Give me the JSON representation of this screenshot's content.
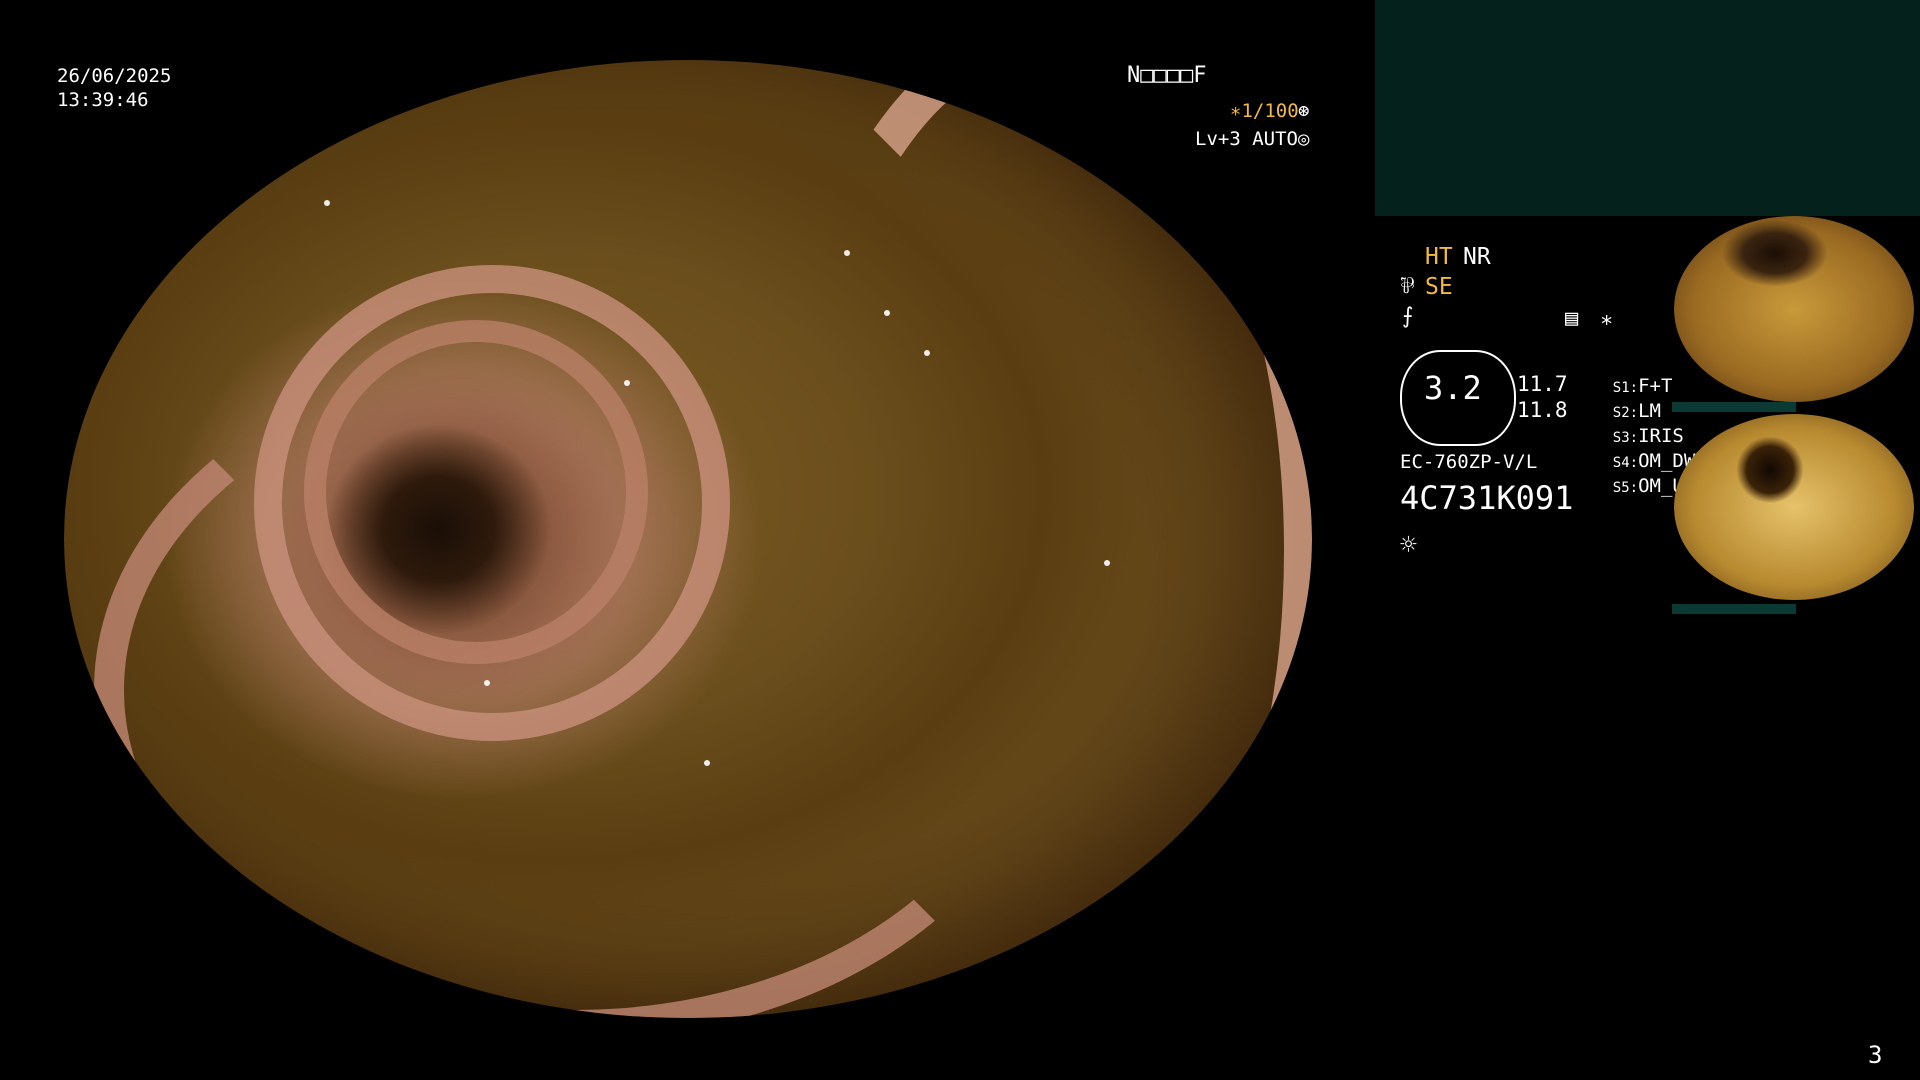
{
  "timestamp": {
    "date": "26/06/2025",
    "time": "13:39:46"
  },
  "top_right": {
    "status": "N□□□□F",
    "shutter": "∗1/100",
    "shutter_icon": "⊛",
    "level": "Lv+3 AUTO",
    "level_icon": "◎"
  },
  "settings": {
    "ht": "HT",
    "nr": "NR",
    "se": "SE",
    "se_icon": "⅌",
    "filter_icon": "⨍",
    "memory_icon": "▤",
    "memory_star": "∗",
    "scope_value": "3.2",
    "scope_val_a": "11.7",
    "scope_val_b": "11.8",
    "scope_model": "EC-760ZP-V/L",
    "serial": "4C731K091",
    "brightness_icon": "☼"
  },
  "switches": [
    {
      "key": "S1:",
      "value": "F+T"
    },
    {
      "key": "S2:",
      "value": "LM"
    },
    {
      "key": "S3:",
      "value": "IRIS"
    },
    {
      "key": "S4:",
      "value": "OM_DW"
    },
    {
      "key": "S5:",
      "value": "OM_UP"
    }
  ],
  "page_number": "3",
  "colors": {
    "accent_yellow": "#f4b940",
    "panel_teal": "#04211c",
    "thumb_bar": "#0b3a34"
  }
}
